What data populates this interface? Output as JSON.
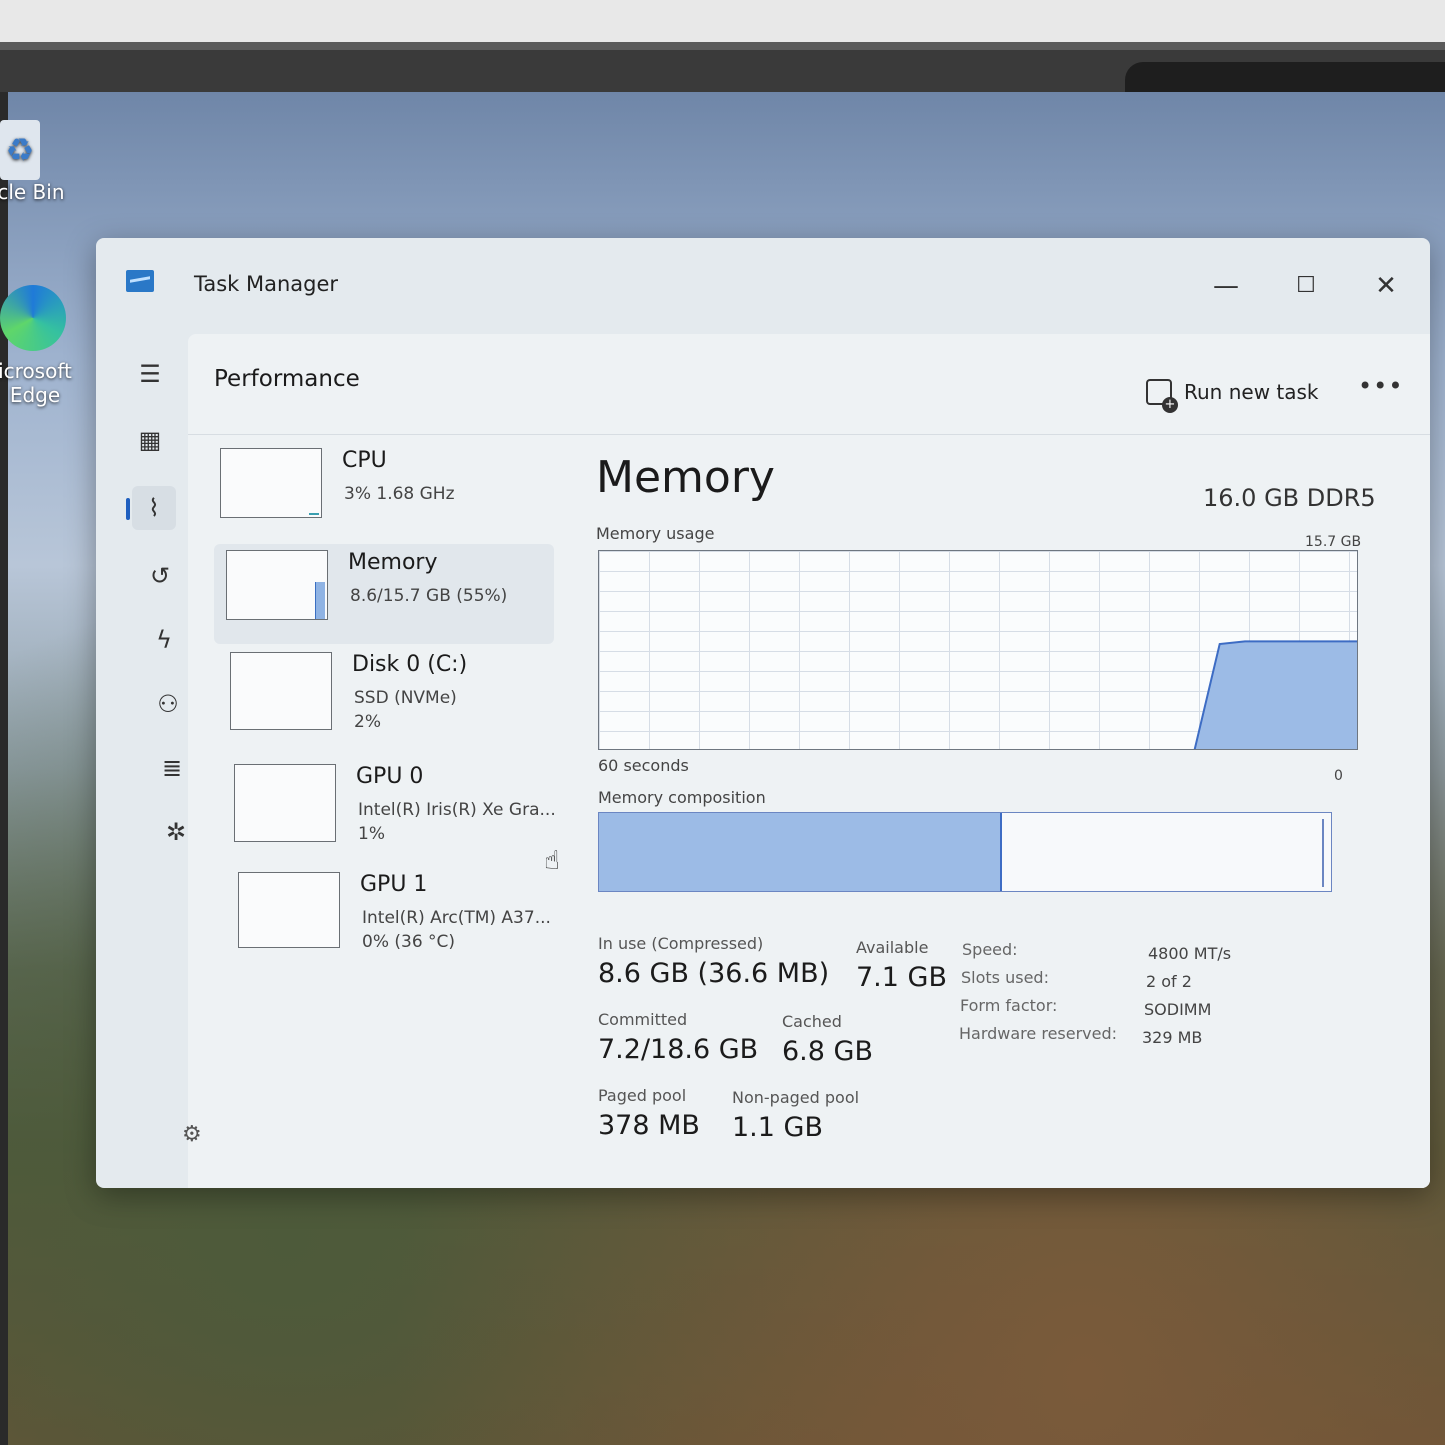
{
  "desktop": {
    "icons": [
      {
        "label": "ycle Bin"
      },
      {
        "label_line1": "icrosoft",
        "label_line2": "Edge"
      }
    ]
  },
  "window": {
    "title": "Task Manager",
    "controls": {
      "minimize": "—",
      "maximize": "☐",
      "close": "✕"
    }
  },
  "nav": {
    "icons": [
      "hamburger-icon",
      "processes-icon",
      "performance-icon",
      "app-history-icon",
      "startup-apps-icon",
      "users-icon",
      "details-icon",
      "services-icon",
      "settings-icon"
    ],
    "active": "performance"
  },
  "header": {
    "title": "Performance",
    "run_new_task": "Run new task",
    "more": "•••"
  },
  "devices": [
    {
      "name": "CPU",
      "line1": "3%  1.68 GHz",
      "line2": "",
      "usage_percent": 3
    },
    {
      "name": "Memory",
      "line1": "8.6/15.7 GB (55%)",
      "line2": "",
      "usage_percent": 55,
      "selected": true
    },
    {
      "name": "Disk 0 (C:)",
      "line1": "SSD (NVMe)",
      "line2": "2%",
      "usage_percent": 2
    },
    {
      "name": "GPU 0",
      "line1": "Intel(R) Iris(R) Xe Gra...",
      "line2": "1%",
      "usage_percent": 1
    },
    {
      "name": "GPU 1",
      "line1": "Intel(R) Arc(TM) A37...",
      "line2": "0% (36 °C)",
      "usage_percent": 0
    }
  ],
  "memory": {
    "title": "Memory",
    "spec": "16.0 GB DDR5",
    "usage_label": "Memory usage",
    "usage_max_label": "15.7 GB",
    "time_label": "60 seconds",
    "zero_label": "0",
    "composition_label": "Memory composition",
    "composition": {
      "in_use_fraction": 0.55,
      "standby_end_fraction": 0.99
    },
    "stats": {
      "in_use_label": "In use (Compressed)",
      "in_use_value": "8.6 GB (36.6 MB)",
      "available_label": "Available",
      "available_value": "7.1 GB",
      "committed_label": "Committed",
      "committed_value": "7.2/18.6 GB",
      "cached_label": "Cached",
      "cached_value": "6.8 GB",
      "paged_pool_label": "Paged pool",
      "paged_pool_value": "378 MB",
      "non_paged_pool_label": "Non-paged pool",
      "non_paged_pool_value": "1.1 GB"
    },
    "specs": [
      {
        "label": "Speed:",
        "value": "4800 MT/s"
      },
      {
        "label": "Slots used:",
        "value": "2 of 2"
      },
      {
        "label": "Form factor:",
        "value": "SODIMM"
      },
      {
        "label": "Hardware reserved:",
        "value": "329 MB"
      }
    ]
  },
  "chart_data": {
    "type": "area",
    "xlabel": "60 seconds",
    "ylabel": "Memory usage",
    "ylim": [
      0,
      15.7
    ],
    "x": [
      60,
      13,
      11,
      9,
      0
    ],
    "series": [
      {
        "values": [
          0,
          0,
          8.4,
          8.6,
          8.6
        ]
      }
    ],
    "grid": true
  },
  "colors": {
    "accent": "#1f5fbf",
    "graph_fill": "#9cbbe6",
    "graph_line": "#3d6cc4"
  }
}
